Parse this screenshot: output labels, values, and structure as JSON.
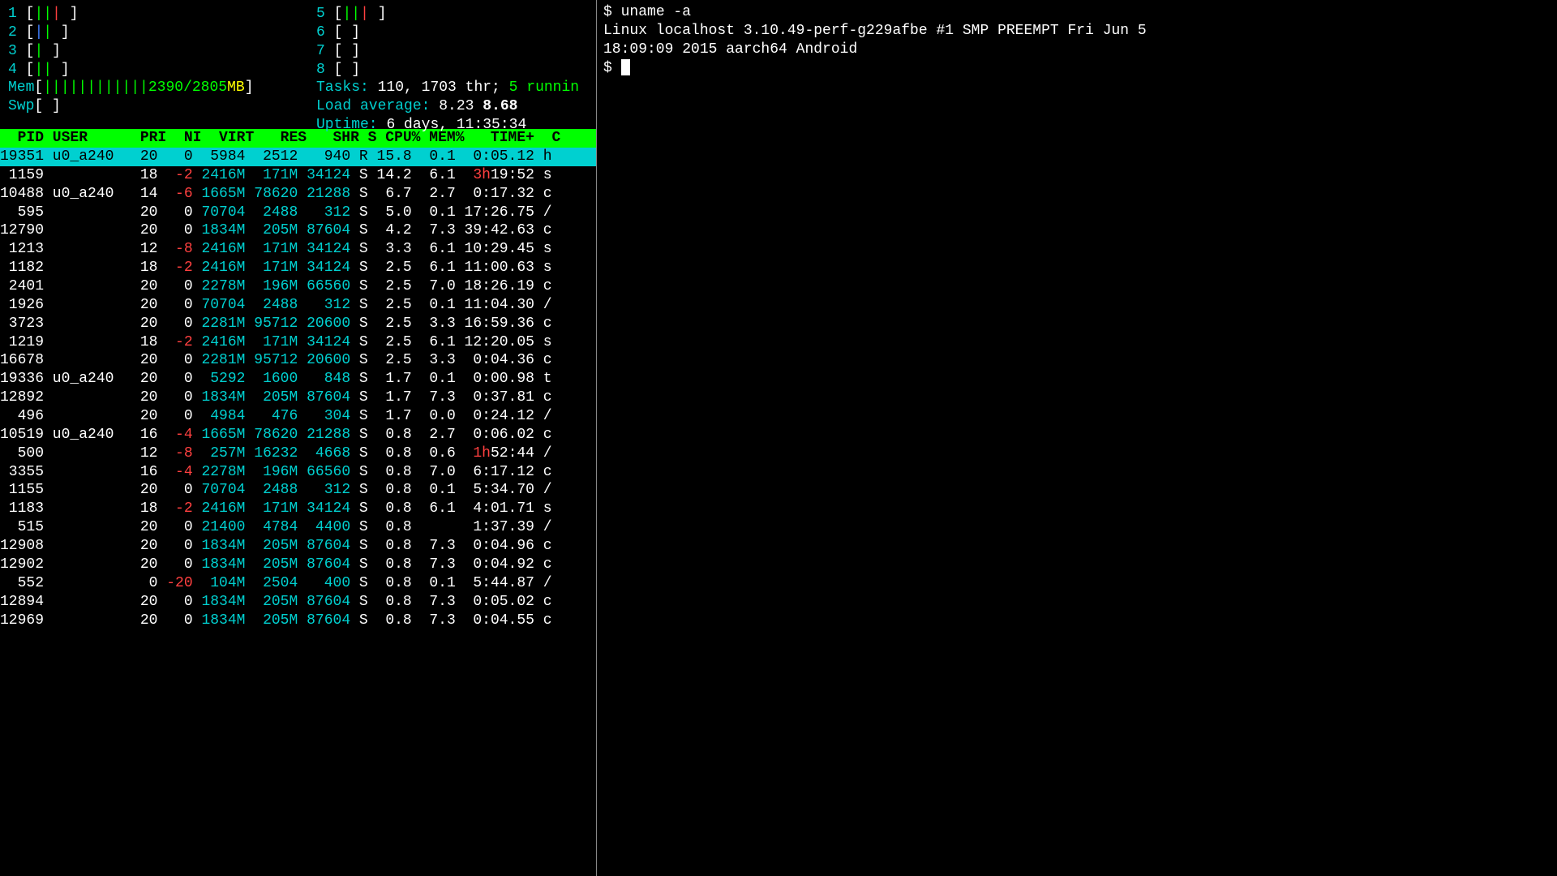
{
  "htop": {
    "cpus": [
      {
        "num": "1",
        "bars": "|||",
        "colors": [
          "green",
          "green",
          "red"
        ]
      },
      {
        "num": "2",
        "bars": "||",
        "colors": [
          "blue",
          "green"
        ]
      },
      {
        "num": "3",
        "bars": "|",
        "colors": [
          "green"
        ]
      },
      {
        "num": "4",
        "bars": "||",
        "colors": [
          "green",
          "green"
        ]
      },
      {
        "num": "5",
        "bars": "|||",
        "colors": [
          "green",
          "green",
          "red"
        ]
      },
      {
        "num": "6",
        "bars": "",
        "colors": []
      },
      {
        "num": "7",
        "bars": "",
        "colors": []
      },
      {
        "num": "8",
        "bars": "",
        "colors": []
      }
    ],
    "mem": {
      "label": "Mem",
      "bars": "||||||||||||",
      "used": "2390",
      "total": "2805",
      "unit": "MB"
    },
    "swp": {
      "label": "Swp"
    },
    "tasks": {
      "label": "Tasks:",
      "total": "110",
      "threads": "1703 thr;",
      "running": "5 runnin"
    },
    "load": {
      "label": "Load average:",
      "v1": "8.23",
      "v2": "8.68"
    },
    "uptime": {
      "label": "Uptime:",
      "value": "6 days, 11:35:34"
    },
    "columns": "  PID USER      PRI  NI  VIRT   RES   SHR S CPU% MEM%   TIME+  C",
    "selected": {
      "pid": "19351",
      "user": "u0_a240",
      "pri": "20",
      "ni": "0",
      "virt": "5984",
      "res": "2512",
      "shr": "940",
      "s": "R",
      "cpu": "15.8",
      "mem": "0.1",
      "time": "0:05.12",
      "cmd": "h"
    },
    "rows": [
      {
        "pid": "1159",
        "user": "",
        "pri": "18",
        "ni": "-2",
        "virt": "2416M",
        "res": "171M",
        "shr": "34124",
        "s": "S",
        "cpu": "14.2",
        "mem": "6.1",
        "time": "3h19:52",
        "time_red": "3h",
        "time_rest": "19:52",
        "cmd": "s"
      },
      {
        "pid": "10488",
        "user": "u0_a240",
        "pri": "14",
        "ni": "-6",
        "virt": "1665M",
        "res": "78620",
        "shr": "21288",
        "s": "S",
        "cpu": "6.7",
        "mem": "2.7",
        "time": "0:17.32",
        "cmd": "c"
      },
      {
        "pid": "595",
        "user": "",
        "pri": "20",
        "ni": "0",
        "virt": "70704",
        "res": "2488",
        "shr": "312",
        "s": "S",
        "cpu": "5.0",
        "mem": "0.1",
        "time": "17:26.75",
        "cmd": "/"
      },
      {
        "pid": "12790",
        "user": "",
        "pri": "20",
        "ni": "0",
        "virt": "1834M",
        "res": "205M",
        "shr": "87604",
        "s": "S",
        "cpu": "4.2",
        "mem": "7.3",
        "time": "39:42.63",
        "cmd": "c"
      },
      {
        "pid": "1213",
        "user": "",
        "pri": "12",
        "ni": "-8",
        "virt": "2416M",
        "res": "171M",
        "shr": "34124",
        "s": "S",
        "cpu": "3.3",
        "mem": "6.1",
        "time": "10:29.45",
        "cmd": "s"
      },
      {
        "pid": "1182",
        "user": "",
        "pri": "18",
        "ni": "-2",
        "virt": "2416M",
        "res": "171M",
        "shr": "34124",
        "s": "S",
        "cpu": "2.5",
        "mem": "6.1",
        "time": "11:00.63",
        "cmd": "s"
      },
      {
        "pid": "2401",
        "user": "",
        "pri": "20",
        "ni": "0",
        "virt": "2278M",
        "res": "196M",
        "shr": "66560",
        "s": "S",
        "cpu": "2.5",
        "mem": "7.0",
        "time": "18:26.19",
        "cmd": "c"
      },
      {
        "pid": "1926",
        "user": "",
        "pri": "20",
        "ni": "0",
        "virt": "70704",
        "res": "2488",
        "shr": "312",
        "s": "S",
        "cpu": "2.5",
        "mem": "0.1",
        "time": "11:04.30",
        "cmd": "/"
      },
      {
        "pid": "3723",
        "user": "",
        "pri": "20",
        "ni": "0",
        "virt": "2281M",
        "res": "95712",
        "shr": "20600",
        "s": "S",
        "cpu": "2.5",
        "mem": "3.3",
        "time": "16:59.36",
        "cmd": "c"
      },
      {
        "pid": "1219",
        "user": "",
        "pri": "18",
        "ni": "-2",
        "virt": "2416M",
        "res": "171M",
        "shr": "34124",
        "s": "S",
        "cpu": "2.5",
        "mem": "6.1",
        "time": "12:20.05",
        "cmd": "s"
      },
      {
        "pid": "16678",
        "user": "",
        "pri": "20",
        "ni": "0",
        "virt": "2281M",
        "res": "95712",
        "shr": "20600",
        "s": "S",
        "cpu": "2.5",
        "mem": "3.3",
        "time": "0:04.36",
        "cmd": "c"
      },
      {
        "pid": "19336",
        "user": "u0_a240",
        "pri": "20",
        "ni": "0",
        "virt": "5292",
        "res": "1600",
        "shr": "848",
        "s": "S",
        "cpu": "1.7",
        "mem": "0.1",
        "time": "0:00.98",
        "cmd": "t"
      },
      {
        "pid": "12892",
        "user": "",
        "pri": "20",
        "ni": "0",
        "virt": "1834M",
        "res": "205M",
        "shr": "87604",
        "s": "S",
        "cpu": "1.7",
        "mem": "7.3",
        "time": "0:37.81",
        "cmd": "c"
      },
      {
        "pid": "496",
        "user": "",
        "pri": "20",
        "ni": "0",
        "virt": "4984",
        "res": "476",
        "shr": "304",
        "s": "S",
        "cpu": "1.7",
        "mem": "0.0",
        "time": "0:24.12",
        "cmd": "/"
      },
      {
        "pid": "10519",
        "user": "u0_a240",
        "pri": "16",
        "ni": "-4",
        "virt": "1665M",
        "res": "78620",
        "shr": "21288",
        "s": "S",
        "cpu": "0.8",
        "mem": "2.7",
        "time": "0:06.02",
        "cmd": "c"
      },
      {
        "pid": "500",
        "user": "",
        "pri": "12",
        "ni": "-8",
        "virt": "257M",
        "res": "16232",
        "shr": "4668",
        "s": "S",
        "cpu": "0.8",
        "mem": "0.6",
        "time": "1h52:44",
        "time_red": "1h",
        "time_rest": "52:44",
        "cmd": "/"
      },
      {
        "pid": "3355",
        "user": "",
        "pri": "16",
        "ni": "-4",
        "virt": "2278M",
        "res": "196M",
        "shr": "66560",
        "s": "S",
        "cpu": "0.8",
        "mem": "7.0",
        "time": "6:17.12",
        "cmd": "c"
      },
      {
        "pid": "1155",
        "user": "",
        "pri": "20",
        "ni": "0",
        "virt": "70704",
        "res": "2488",
        "shr": "312",
        "s": "S",
        "cpu": "0.8",
        "mem": "0.1",
        "time": "5:34.70",
        "cmd": "/"
      },
      {
        "pid": "1183",
        "user": "",
        "pri": "18",
        "ni": "-2",
        "virt": "2416M",
        "res": "171M",
        "shr": "34124",
        "s": "S",
        "cpu": "0.8",
        "mem": "6.1",
        "time": "4:01.71",
        "cmd": "s"
      },
      {
        "pid": "515",
        "user": "",
        "pri": "20",
        "ni": "0",
        "virt": "21400",
        "res": "4784",
        "shr": "4400",
        "s": "S",
        "cpu": "0.8",
        "mem": "",
        "time": "1:37.39",
        "cmd": "/"
      },
      {
        "pid": "12908",
        "user": "",
        "pri": "20",
        "ni": "0",
        "virt": "1834M",
        "res": "205M",
        "shr": "87604",
        "s": "S",
        "cpu": "0.8",
        "mem": "7.3",
        "time": "0:04.96",
        "cmd": "c"
      },
      {
        "pid": "12902",
        "user": "",
        "pri": "20",
        "ni": "0",
        "virt": "1834M",
        "res": "205M",
        "shr": "87604",
        "s": "S",
        "cpu": "0.8",
        "mem": "7.3",
        "time": "0:04.92",
        "cmd": "c"
      },
      {
        "pid": "552",
        "user": "",
        "pri": "0",
        "ni": "-20",
        "virt": "104M",
        "res": "2504",
        "shr": "400",
        "s": "S",
        "cpu": "0.8",
        "mem": "0.1",
        "time": "5:44.87",
        "cmd": "/"
      },
      {
        "pid": "12894",
        "user": "",
        "pri": "20",
        "ni": "0",
        "virt": "1834M",
        "res": "205M",
        "shr": "87604",
        "s": "S",
        "cpu": "0.8",
        "mem": "7.3",
        "time": "0:05.02",
        "cmd": "c"
      },
      {
        "pid": "12969",
        "user": "",
        "pri": "20",
        "ni": "0",
        "virt": "1834M",
        "res": "205M",
        "shr": "87604",
        "s": "S",
        "cpu": "0.8",
        "mem": "7.3",
        "time": "0:04.55",
        "cmd": "c"
      }
    ]
  },
  "terminal": {
    "prompt": "$ ",
    "command": "uname -a",
    "output1": "Linux localhost 3.10.49-perf-g229afbe #1 SMP PREEMPT Fri Jun 5",
    "output2": "18:09:09 2015 aarch64 Android",
    "prompt2": "$ "
  }
}
